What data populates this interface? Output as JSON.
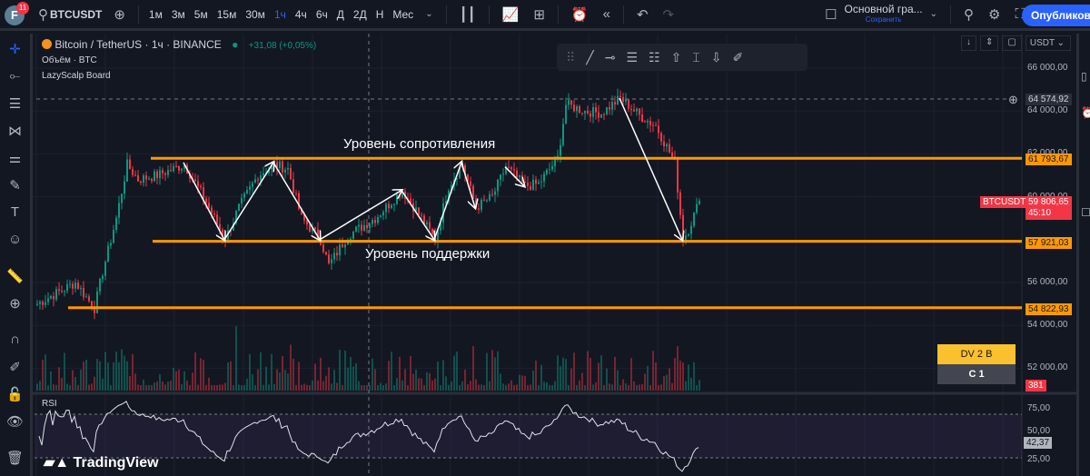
{
  "topbar": {
    "avatar_letter": "F",
    "notifications": "11",
    "symbol": "BTCUSDT",
    "intervals": [
      "1м",
      "3м",
      "5м",
      "15м",
      "30м",
      "1ч",
      "4ч",
      "6ч",
      "Д",
      "2Д",
      "Н",
      "Мес"
    ],
    "active_interval": "1ч",
    "layout_name": "Основной гра...",
    "save_label": "Сохранить",
    "publish_label": "Опубликовать"
  },
  "legend": {
    "title": "Bitcoin / TetherUS · 1ч · BINANCE",
    "change": "+31,08 (+0,05%)",
    "volume": "Объём · BTC",
    "indicator": "LazyScalp Board",
    "rsi": "RSI"
  },
  "scale": {
    "currency": "USDT"
  },
  "price_axis": [
    "66 000,00",
    "64 000,00",
    "62 000,00",
    "60 000,00",
    "56 000,00",
    "54 000,00",
    "52 000,00"
  ],
  "price_levels": [
    66000,
    64000,
    62000,
    60000,
    56000,
    54000,
    52000
  ],
  "tags": {
    "crosshair": "64 574,92",
    "resistance": "61 793,67",
    "current_symbol": "BTCUSDT",
    "current": "59 806,65",
    "countdown": "45:10",
    "support": "57 921,03",
    "low": "54 822,93",
    "volume": "381",
    "rsi": "42,37"
  },
  "rsi_axis": [
    "75,00",
    "50,00",
    "25,00"
  ],
  "board": {
    "top": "DV 2 B",
    "bottom": "C 1"
  },
  "annotations": {
    "resistance": "Уровень сопротивления",
    "support": "Уровень поддержки"
  },
  "watermark": "TradingView",
  "colors": {
    "up": "#089981",
    "down": "#f23645",
    "level": "#ff9800",
    "accent": "#2962ff"
  },
  "chart_data": {
    "type": "candlestick",
    "symbol": "BTCUSDT",
    "timeframe": "1h",
    "path": [
      [
        0,
        55000
      ],
      [
        7,
        55500
      ],
      [
        14,
        56000
      ],
      [
        21,
        54800
      ],
      [
        24,
        56500
      ],
      [
        29,
        59000
      ],
      [
        33,
        61500
      ],
      [
        37,
        60800
      ],
      [
        44,
        61000
      ],
      [
        54,
        61500
      ],
      [
        61,
        60000
      ],
      [
        69,
        58000
      ],
      [
        74,
        59500
      ],
      [
        81,
        61000
      ],
      [
        87,
        61500
      ],
      [
        92,
        61300
      ],
      [
        97,
        59000
      ],
      [
        104,
        58000
      ],
      [
        107,
        56800
      ],
      [
        114,
        58200
      ],
      [
        124,
        59000
      ],
      [
        134,
        60300
      ],
      [
        141,
        59000
      ],
      [
        146,
        58000
      ],
      [
        151,
        60500
      ],
      [
        156,
        61500
      ],
      [
        161,
        59500
      ],
      [
        167,
        60000
      ],
      [
        172,
        61400
      ],
      [
        179,
        60500
      ],
      [
        184,
        60600
      ],
      [
        191,
        61800
      ],
      [
        194,
        64300
      ],
      [
        201,
        64000
      ],
      [
        207,
        63900
      ],
      [
        214,
        64600
      ],
      [
        221,
        63800
      ],
      [
        227,
        63300
      ],
      [
        234,
        61600
      ],
      [
        237,
        58000
      ],
      [
        239,
        58500
      ],
      [
        243,
        59806
      ]
    ],
    "levels": [
      61793.67,
      57921.03,
      54822.93
    ],
    "zigzag": [
      [
        [
          54,
          61600
        ],
        [
          69,
          58000
        ],
        [
          87,
          61600
        ],
        [
          104,
          58000
        ],
        [
          134,
          60300
        ],
        [
          146,
          58000
        ],
        [
          156,
          61600
        ],
        [
          161,
          59500
        ]
      ],
      [
        [
          172,
          61400
        ],
        [
          179,
          60500
        ]
      ],
      [
        [
          214,
          64600
        ],
        [
          237,
          58000
        ]
      ]
    ],
    "rsi_range": [
      0,
      100
    ]
  }
}
